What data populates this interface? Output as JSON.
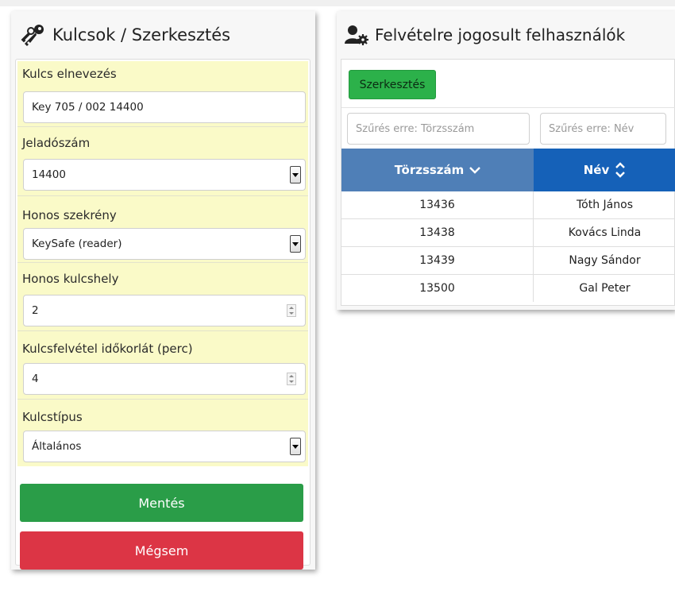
{
  "keys_card": {
    "title": "Kulcsok / Szerkesztés",
    "icon": "keys-icon",
    "fields": [
      {
        "label": "Kulcs elnevezés",
        "type": "text",
        "value": "Key 705 / 002 14400"
      },
      {
        "label": "Jeladószám",
        "type": "select",
        "value": "14400"
      },
      {
        "label": "Honos szekrény",
        "type": "select",
        "value": "KeySafe (reader)"
      },
      {
        "label": "Honos kulcshely",
        "type": "number",
        "value": "2"
      },
      {
        "label": "Kulcsfelvétel időkorlát (perc)",
        "type": "number",
        "value": "4"
      },
      {
        "label": "Kulcstípus",
        "type": "select",
        "value": "Általános"
      }
    ],
    "save_label": "Mentés",
    "cancel_label": "Mégsem",
    "colors": {
      "field_bg": "#fafac8",
      "save": "#2a9d48",
      "cancel": "#dc3545"
    }
  },
  "users_card": {
    "title": "Felvételre jogosult felhasználók",
    "icon": "user-gear-icon",
    "edit_label": "Szerkesztés",
    "filters": {
      "id_placeholder": "Szűrés erre: Törzsszám",
      "name_placeholder": "Szűrés erre: Név"
    },
    "columns": [
      {
        "label": "Törzsszám",
        "sort": "descending"
      },
      {
        "label": "Név",
        "sort": "unsorted"
      }
    ],
    "rows": [
      {
        "id": "13436",
        "name": "Tóth János"
      },
      {
        "id": "13438",
        "name": "Kovács Linda"
      },
      {
        "id": "13439",
        "name": "Nagy Sándor"
      },
      {
        "id": "13500",
        "name": "Gal Peter"
      }
    ],
    "colors": {
      "header_active": "#4f7fb7",
      "header": "#1561b8",
      "edit": "#2cb14a"
    }
  }
}
